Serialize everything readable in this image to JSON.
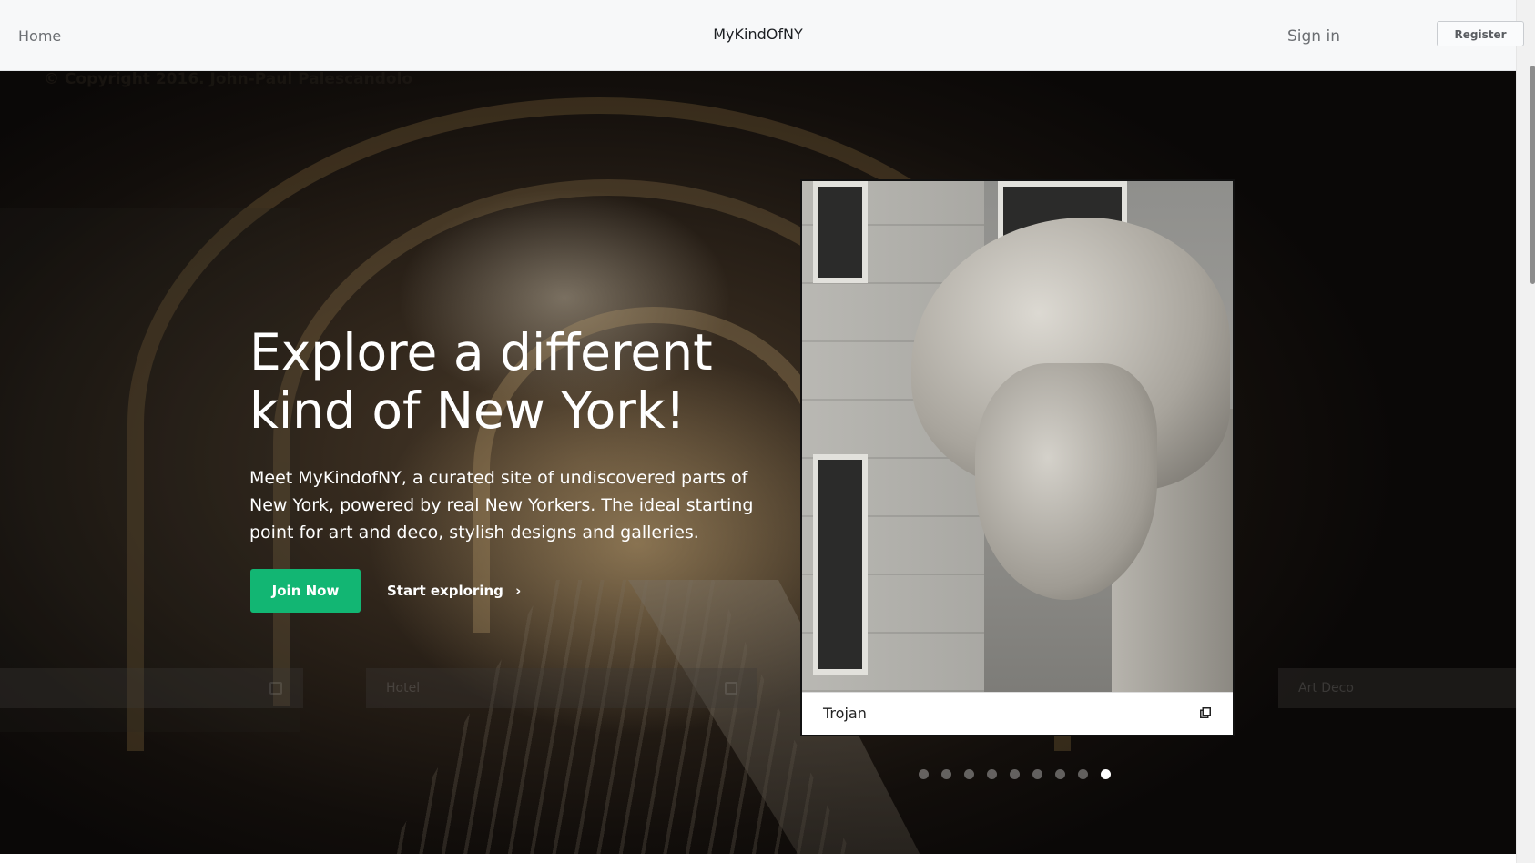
{
  "navbar": {
    "home_label": "Home",
    "brand": "MyKindOfNY",
    "signin_label": "Sign in",
    "register_label": "Register"
  },
  "hero": {
    "photo_credit": "© Copyright 2016. John-Paul Palescandolo",
    "title": "Explore a different kind of New York!",
    "description": "Meet MyKindofNY, a curated site of undiscovered parts of New York, powered by real New Yorkers. The ideal starting point for art and deco, stylish designs and galleries.",
    "join_label": "Join Now",
    "explore_label": "Start exploring",
    "explore_icon": "chevron-right-icon",
    "side_labels": [
      "Hotel",
      "Art Deco"
    ]
  },
  "featured_card": {
    "title": "Trojan",
    "icon": "external-link-icon"
  },
  "carousel": {
    "dot_count": 9,
    "active_index": 8
  },
  "colors": {
    "accent": "#12b673",
    "navbar_bg": "#f7f8f9"
  }
}
